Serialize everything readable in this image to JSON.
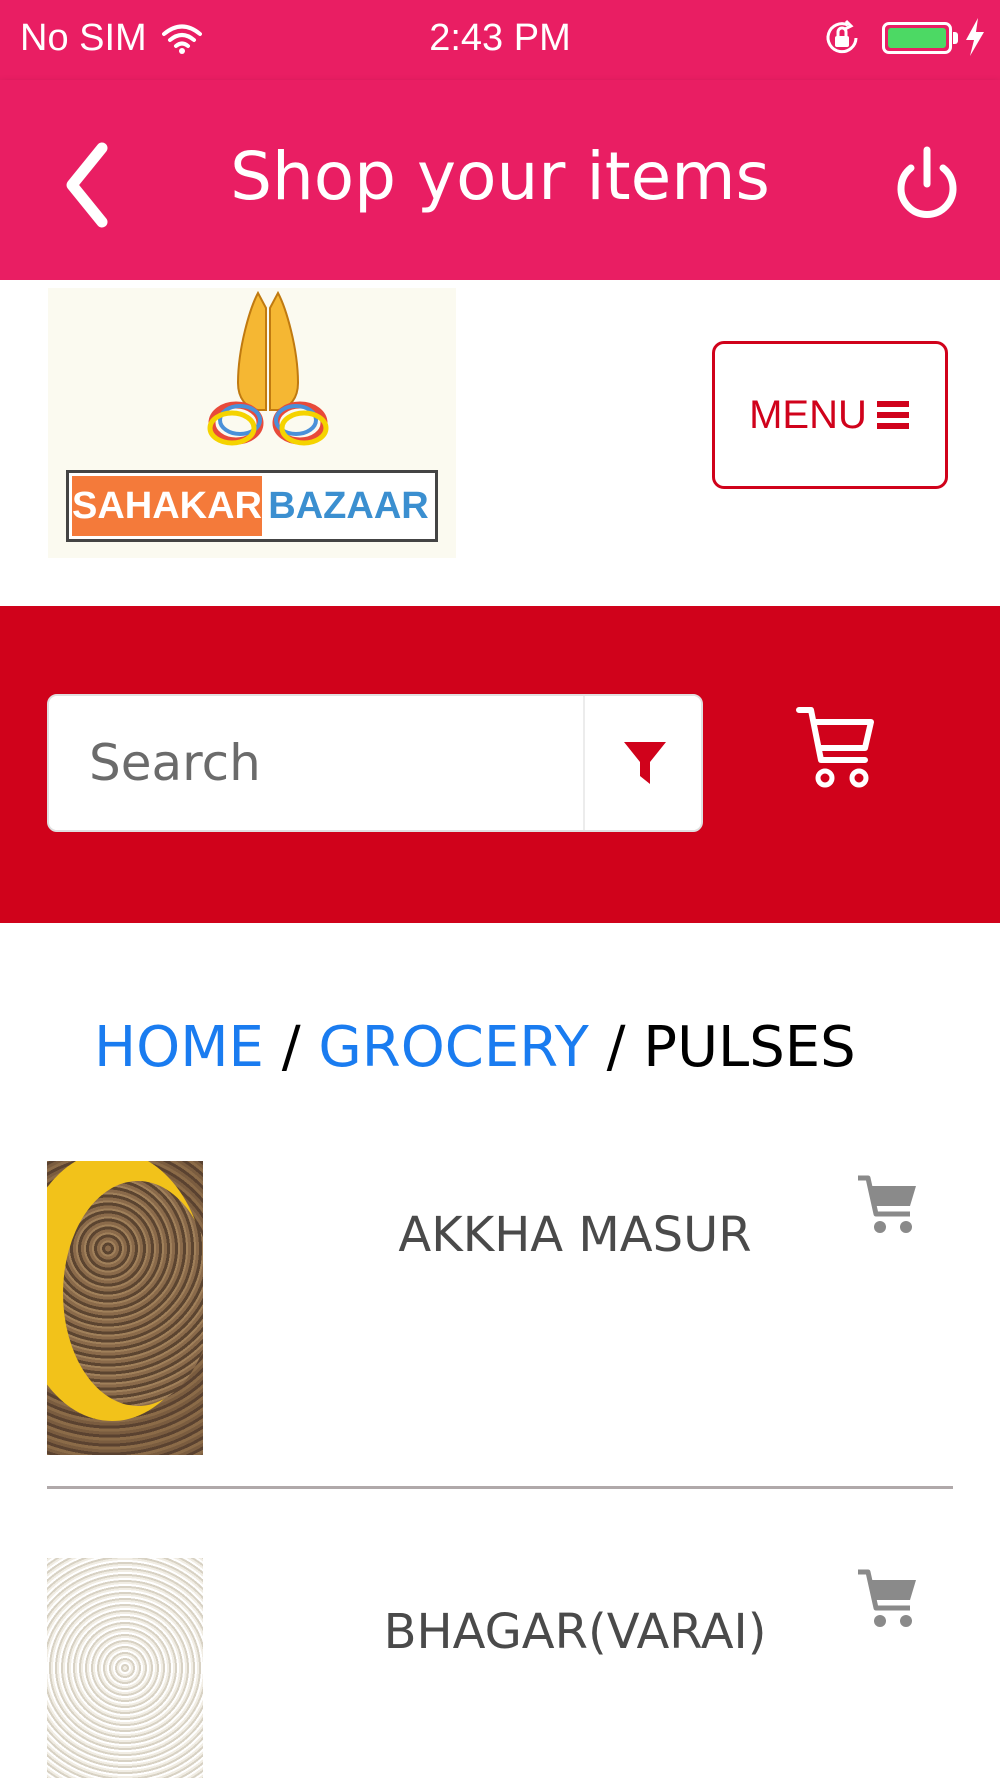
{
  "status_bar": {
    "carrier": "No SIM",
    "time": "2:43 PM",
    "battery_color": "#4cd964"
  },
  "navbar": {
    "title": "Shop your items",
    "back_icon": "chevron-left-icon",
    "power_icon": "power-icon",
    "background_color": "#e91e63"
  },
  "logo": {
    "text_left": "SAHAKAR",
    "text_right": "BAZAAR"
  },
  "menu_button": {
    "label": "MENU",
    "icon": "hamburger-icon",
    "color": "#d0021b"
  },
  "search": {
    "placeholder": "Search",
    "filter_icon": "filter-icon",
    "cart_icon": "cart-icon",
    "band_color": "#d0021b"
  },
  "breadcrumb": {
    "items": [
      "HOME",
      "GROCERY",
      "PULSES"
    ],
    "separator": "/",
    "link_color": "#1a7cf0"
  },
  "products": [
    {
      "name": "AKKHA MASUR",
      "cart_icon": "add-to-cart-icon"
    },
    {
      "name": "BHAGAR(VARAI)",
      "cart_icon": "add-to-cart-icon"
    }
  ]
}
